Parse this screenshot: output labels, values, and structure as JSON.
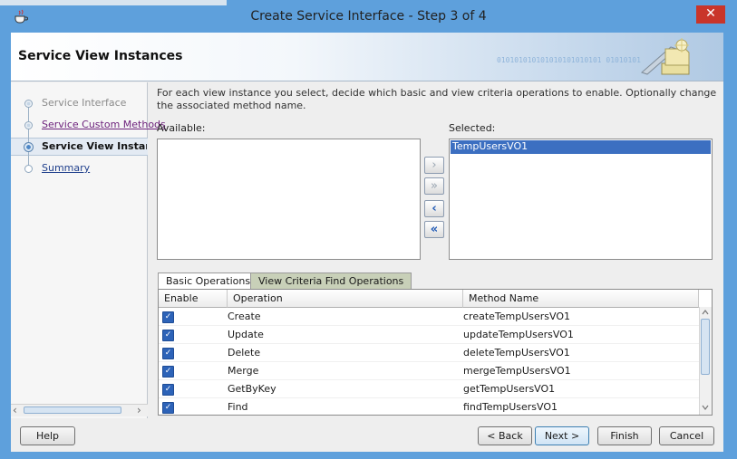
{
  "window": {
    "title": "Create Service Interface - Step 3 of 4",
    "close_glyph": "✕",
    "app_icon": "java-cup-icon"
  },
  "header": {
    "title": "Service View Instances",
    "binary_text": "010101010101010101010101 01010101"
  },
  "nav": {
    "items": [
      {
        "label": "Service Interface",
        "state": "done"
      },
      {
        "label": "Service Custom Methods",
        "state": "done-link"
      },
      {
        "label": "Service View Instance",
        "state": "current"
      },
      {
        "label": "Summary",
        "state": "link"
      }
    ],
    "scroll_left": "‹",
    "scroll_right": "›"
  },
  "description": "For each view instance you select, decide which basic and view criteria operations to enable. Optionally change the associated method name.",
  "available": {
    "label": "Available:",
    "items": []
  },
  "selected": {
    "label": "Selected:",
    "items": [
      "TempUsersVO1"
    ]
  },
  "shuttle": {
    "add": "›",
    "add_all": "»",
    "remove": "‹",
    "remove_all": "«"
  },
  "tabs": [
    {
      "label": "Basic Operations",
      "active": true
    },
    {
      "label": "View Criteria Find Operations",
      "active": false
    }
  ],
  "grid": {
    "columns": [
      "Enable",
      "Operation",
      "Method Name"
    ],
    "rows": [
      {
        "enabled": true,
        "operation": "Create",
        "method": "createTempUsersVO1"
      },
      {
        "enabled": true,
        "operation": "Update",
        "method": "updateTempUsersVO1"
      },
      {
        "enabled": true,
        "operation": "Delete",
        "method": "deleteTempUsersVO1"
      },
      {
        "enabled": true,
        "operation": "Merge",
        "method": "mergeTempUsersVO1"
      },
      {
        "enabled": true,
        "operation": "GetByKey",
        "method": "getTempUsersVO1"
      },
      {
        "enabled": true,
        "operation": "Find",
        "method": "findTempUsersVO1"
      }
    ],
    "check_glyph": "✓"
  },
  "buttons": {
    "help": "Help",
    "back": "< Back",
    "next": "Next >",
    "finish": "Finish",
    "cancel": "Cancel"
  },
  "colors": {
    "title_bar": "#5ea0dc",
    "selection": "#3c6fc1",
    "close": "#c9352a"
  }
}
